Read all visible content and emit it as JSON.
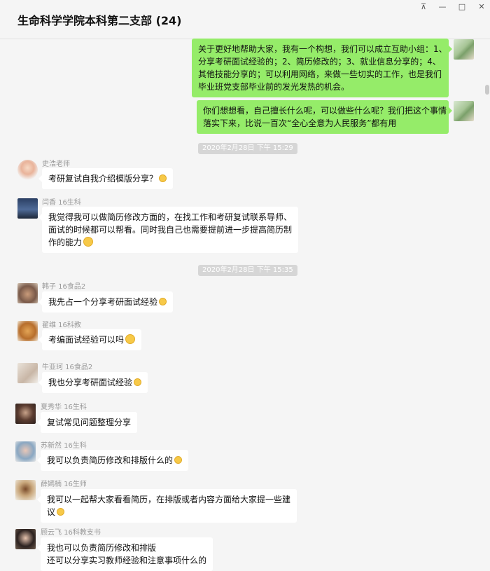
{
  "window": {
    "title": "生命科学学院本科第二支部 (24)",
    "controls": {
      "pin": "⊼",
      "minimize": "—",
      "maximize": "□",
      "close": "✕"
    }
  },
  "messages_out": [
    {
      "lines": [
        "关于更好地帮助大家，我有一个构想，我们可以成立互助小组：1、",
        "分享考研面试经验的；2、简历修改的；3、就业信息分享的；4、",
        "其他技能分享的；可以利用网络，来做一些切实的工作，也是我们",
        "毕业班党支部毕业前的发光发热的机会。"
      ]
    },
    {
      "lines": [
        "你们想想看，自己擅长什么呢，可以做些什么呢？我们把这个事情",
        "落实下来，比说一百次“全心全意为人民服务”都有用"
      ]
    }
  ],
  "timestamps": [
    "2020年2月28日 下午 15:29",
    "2020年2月28日 下午 15:35"
  ],
  "messages_in": [
    {
      "name": "史浩老师",
      "lines": [
        "考研复试自我介绍模版分享？"
      ]
    },
    {
      "name": "闫香 16生科",
      "lines": [
        "我觉得我可以做简历修改方面的，在找工作和考研复试联系导师、",
        "面试的时候都可以帮看。同时我自己也需要提前进一步提高简历制",
        "作的能力"
      ]
    },
    {
      "name": "韩子 16食品2",
      "lines": [
        "我先占一个分享考研面试经验"
      ]
    },
    {
      "name": "翟维 16科教",
      "lines": [
        "考编面试经验可以吗"
      ]
    },
    {
      "name": "牛亚珂 16食品2",
      "lines": [
        "我也分享考研面试经验"
      ]
    },
    {
      "name": "夏秀华 16生科",
      "lines": [
        "复试常见问题整理分享"
      ]
    },
    {
      "name": "苏新然 16生科",
      "lines": [
        "我可以负责简历修改和排版什么的"
      ]
    },
    {
      "name": "薛嫣楠 16生师",
      "lines": [
        "我可以一起帮大家看看简历，在排版或者内容方面给大家提一些建",
        "议"
      ]
    },
    {
      "name": "顾云飞 16科教支书",
      "lines": [
        "我也可以负责简历修改和排版",
        "还可以分享实习教师经验和注意事项什么的"
      ]
    }
  ]
}
